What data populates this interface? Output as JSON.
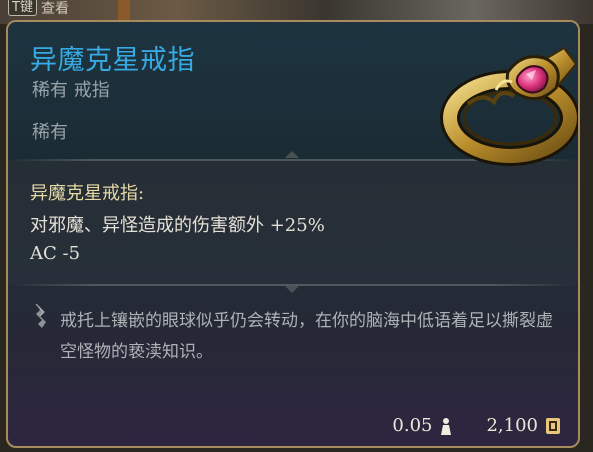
{
  "hud": {
    "hotkey": "T键",
    "hotkey_label": "查看"
  },
  "item": {
    "name": "异魔克星戒指",
    "type_line": "稀有 戒指",
    "rarity": "稀有",
    "effect_title": "异魔克星戒指:",
    "effect_lines": [
      "对邪魔、异怪造成的伤害额外 +25%",
      "AC -5"
    ],
    "lore": "戒托上镶嵌的眼球似乎仍会转动，在你的脑海中低语着足以撕裂虚空怪物的亵渎知识。",
    "weight": "0.05",
    "value": "2,100"
  },
  "colors": {
    "title": "#37a9e3",
    "effect_title": "#e7d9a6",
    "border": "#a98a5c"
  },
  "icons": {
    "item": "gold-ring-with-pink-gem",
    "lore": "quill-icon",
    "weight": "weight-icon",
    "value": "gold-coin-icon"
  }
}
